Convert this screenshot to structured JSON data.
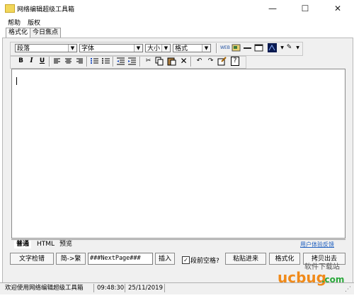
{
  "window": {
    "title": "网络编辑超级工具箱",
    "min": "—",
    "max": "☐",
    "close": "✕"
  },
  "menu": [
    "帮助",
    "版权"
  ],
  "top_tabs": [
    "格式化",
    "今日焦点"
  ],
  "toolbar": {
    "paragraph_select": "段落",
    "font_select": "字体",
    "size_select": "大小",
    "format_select": "格式",
    "icons": [
      "bold-icon",
      "italic-icon",
      "underline-icon",
      "align-left-icon",
      "align-center-icon",
      "align-right-icon",
      "ordered-list-icon",
      "unordered-list-icon",
      "outdent-icon",
      "indent-icon",
      "cut-icon",
      "copy-icon",
      "paste-icon",
      "delete-icon",
      "undo-icon",
      "redo-icon",
      "edit-icon",
      "help-icon"
    ],
    "top_icons": [
      "web-icon",
      "image-icon",
      "horizontal-rule-icon",
      "window-icon",
      "color-icon",
      "pen-icon"
    ],
    "bold": "B",
    "italic": "I",
    "underline": "U"
  },
  "editor": {
    "content": ""
  },
  "bottom_tabs": [
    "普通",
    "HTML",
    "预览"
  ],
  "feedback_link": "用户体验反馈",
  "buttons": {
    "check": "文字检错",
    "convert": "简->繁",
    "separator_value": "###NextPage###",
    "insert": "插入",
    "space_label": "段前空格?",
    "space_checked": true,
    "paste_in": "粘贴进来",
    "format": "格式化",
    "copy_out": "拷贝出去"
  },
  "status": {
    "welcome": "欢迎使用网络编辑超级工具箱",
    "time": "09:48:30",
    "date": "25/11/2019"
  },
  "watermark": {
    "brand": "ucbug",
    "suffix": ".com",
    "tagline": "软件下载站"
  },
  "colors": {
    "panel": "#f0f0f0",
    "link": "#1f5fbf",
    "watermark_orange": "#f08a1a",
    "watermark_green": "#2aa83a"
  }
}
